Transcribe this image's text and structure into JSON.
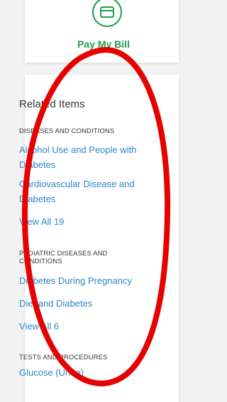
{
  "bill": {
    "label": "Pay My Bill",
    "icon": "credit-card-icon",
    "accent": "#1f9d4a"
  },
  "related": {
    "title": "Related Items",
    "link_color": "#2a86c8",
    "sections": [
      {
        "heading": "DISEASES AND CONDITIONS",
        "links": [
          "Alcohol Use and People with",
          "Diabetes",
          "Cardiovascular Disease and",
          "Diabetes",
          "View All 19"
        ]
      },
      {
        "heading_line1": "PEDIATRIC DISEASES AND",
        "heading_line2": "CONDITIONS",
        "links": [
          "Diabetes During Pregnancy",
          "Diet and Diabetes",
          "View All 6"
        ]
      },
      {
        "heading": "TESTS AND PROCEDURES",
        "links": [
          "Glucose (Urine)"
        ]
      }
    ]
  },
  "annotation": {
    "color": "#e60000"
  }
}
